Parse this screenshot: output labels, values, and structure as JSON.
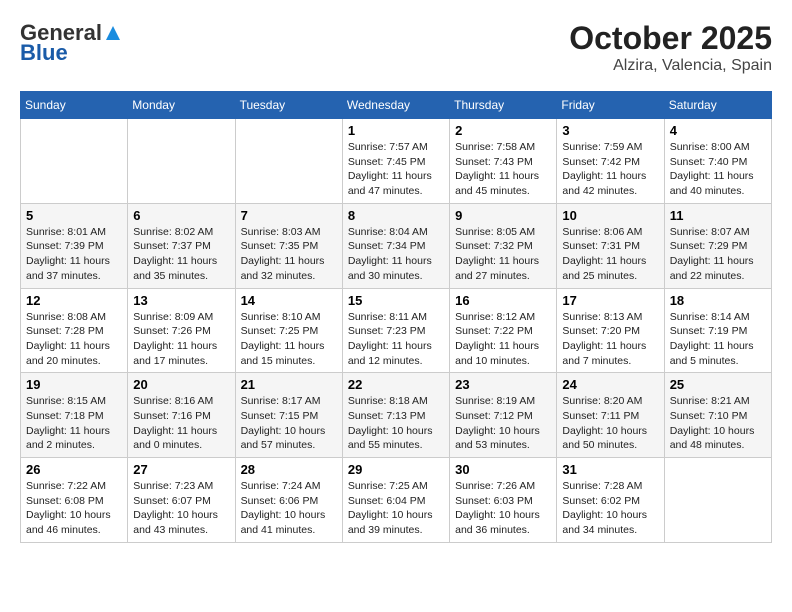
{
  "header": {
    "logo_line1": "General",
    "logo_line2": "Blue",
    "month_year": "October 2025",
    "location": "Alzira, Valencia, Spain"
  },
  "weekdays": [
    "Sunday",
    "Monday",
    "Tuesday",
    "Wednesday",
    "Thursday",
    "Friday",
    "Saturday"
  ],
  "weeks": [
    [
      {
        "day": "",
        "info": ""
      },
      {
        "day": "",
        "info": ""
      },
      {
        "day": "",
        "info": ""
      },
      {
        "day": "1",
        "info": "Sunrise: 7:57 AM\nSunset: 7:45 PM\nDaylight: 11 hours and 47 minutes."
      },
      {
        "day": "2",
        "info": "Sunrise: 7:58 AM\nSunset: 7:43 PM\nDaylight: 11 hours and 45 minutes."
      },
      {
        "day": "3",
        "info": "Sunrise: 7:59 AM\nSunset: 7:42 PM\nDaylight: 11 hours and 42 minutes."
      },
      {
        "day": "4",
        "info": "Sunrise: 8:00 AM\nSunset: 7:40 PM\nDaylight: 11 hours and 40 minutes."
      }
    ],
    [
      {
        "day": "5",
        "info": "Sunrise: 8:01 AM\nSunset: 7:39 PM\nDaylight: 11 hours and 37 minutes."
      },
      {
        "day": "6",
        "info": "Sunrise: 8:02 AM\nSunset: 7:37 PM\nDaylight: 11 hours and 35 minutes."
      },
      {
        "day": "7",
        "info": "Sunrise: 8:03 AM\nSunset: 7:35 PM\nDaylight: 11 hours and 32 minutes."
      },
      {
        "day": "8",
        "info": "Sunrise: 8:04 AM\nSunset: 7:34 PM\nDaylight: 11 hours and 30 minutes."
      },
      {
        "day": "9",
        "info": "Sunrise: 8:05 AM\nSunset: 7:32 PM\nDaylight: 11 hours and 27 minutes."
      },
      {
        "day": "10",
        "info": "Sunrise: 8:06 AM\nSunset: 7:31 PM\nDaylight: 11 hours and 25 minutes."
      },
      {
        "day": "11",
        "info": "Sunrise: 8:07 AM\nSunset: 7:29 PM\nDaylight: 11 hours and 22 minutes."
      }
    ],
    [
      {
        "day": "12",
        "info": "Sunrise: 8:08 AM\nSunset: 7:28 PM\nDaylight: 11 hours and 20 minutes."
      },
      {
        "day": "13",
        "info": "Sunrise: 8:09 AM\nSunset: 7:26 PM\nDaylight: 11 hours and 17 minutes."
      },
      {
        "day": "14",
        "info": "Sunrise: 8:10 AM\nSunset: 7:25 PM\nDaylight: 11 hours and 15 minutes."
      },
      {
        "day": "15",
        "info": "Sunrise: 8:11 AM\nSunset: 7:23 PM\nDaylight: 11 hours and 12 minutes."
      },
      {
        "day": "16",
        "info": "Sunrise: 8:12 AM\nSunset: 7:22 PM\nDaylight: 11 hours and 10 minutes."
      },
      {
        "day": "17",
        "info": "Sunrise: 8:13 AM\nSunset: 7:20 PM\nDaylight: 11 hours and 7 minutes."
      },
      {
        "day": "18",
        "info": "Sunrise: 8:14 AM\nSunset: 7:19 PM\nDaylight: 11 hours and 5 minutes."
      }
    ],
    [
      {
        "day": "19",
        "info": "Sunrise: 8:15 AM\nSunset: 7:18 PM\nDaylight: 11 hours and 2 minutes."
      },
      {
        "day": "20",
        "info": "Sunrise: 8:16 AM\nSunset: 7:16 PM\nDaylight: 11 hours and 0 minutes."
      },
      {
        "day": "21",
        "info": "Sunrise: 8:17 AM\nSunset: 7:15 PM\nDaylight: 10 hours and 57 minutes."
      },
      {
        "day": "22",
        "info": "Sunrise: 8:18 AM\nSunset: 7:13 PM\nDaylight: 10 hours and 55 minutes."
      },
      {
        "day": "23",
        "info": "Sunrise: 8:19 AM\nSunset: 7:12 PM\nDaylight: 10 hours and 53 minutes."
      },
      {
        "day": "24",
        "info": "Sunrise: 8:20 AM\nSunset: 7:11 PM\nDaylight: 10 hours and 50 minutes."
      },
      {
        "day": "25",
        "info": "Sunrise: 8:21 AM\nSunset: 7:10 PM\nDaylight: 10 hours and 48 minutes."
      }
    ],
    [
      {
        "day": "26",
        "info": "Sunrise: 7:22 AM\nSunset: 6:08 PM\nDaylight: 10 hours and 46 minutes."
      },
      {
        "day": "27",
        "info": "Sunrise: 7:23 AM\nSunset: 6:07 PM\nDaylight: 10 hours and 43 minutes."
      },
      {
        "day": "28",
        "info": "Sunrise: 7:24 AM\nSunset: 6:06 PM\nDaylight: 10 hours and 41 minutes."
      },
      {
        "day": "29",
        "info": "Sunrise: 7:25 AM\nSunset: 6:04 PM\nDaylight: 10 hours and 39 minutes."
      },
      {
        "day": "30",
        "info": "Sunrise: 7:26 AM\nSunset: 6:03 PM\nDaylight: 10 hours and 36 minutes."
      },
      {
        "day": "31",
        "info": "Sunrise: 7:28 AM\nSunset: 6:02 PM\nDaylight: 10 hours and 34 minutes."
      },
      {
        "day": "",
        "info": ""
      }
    ]
  ]
}
